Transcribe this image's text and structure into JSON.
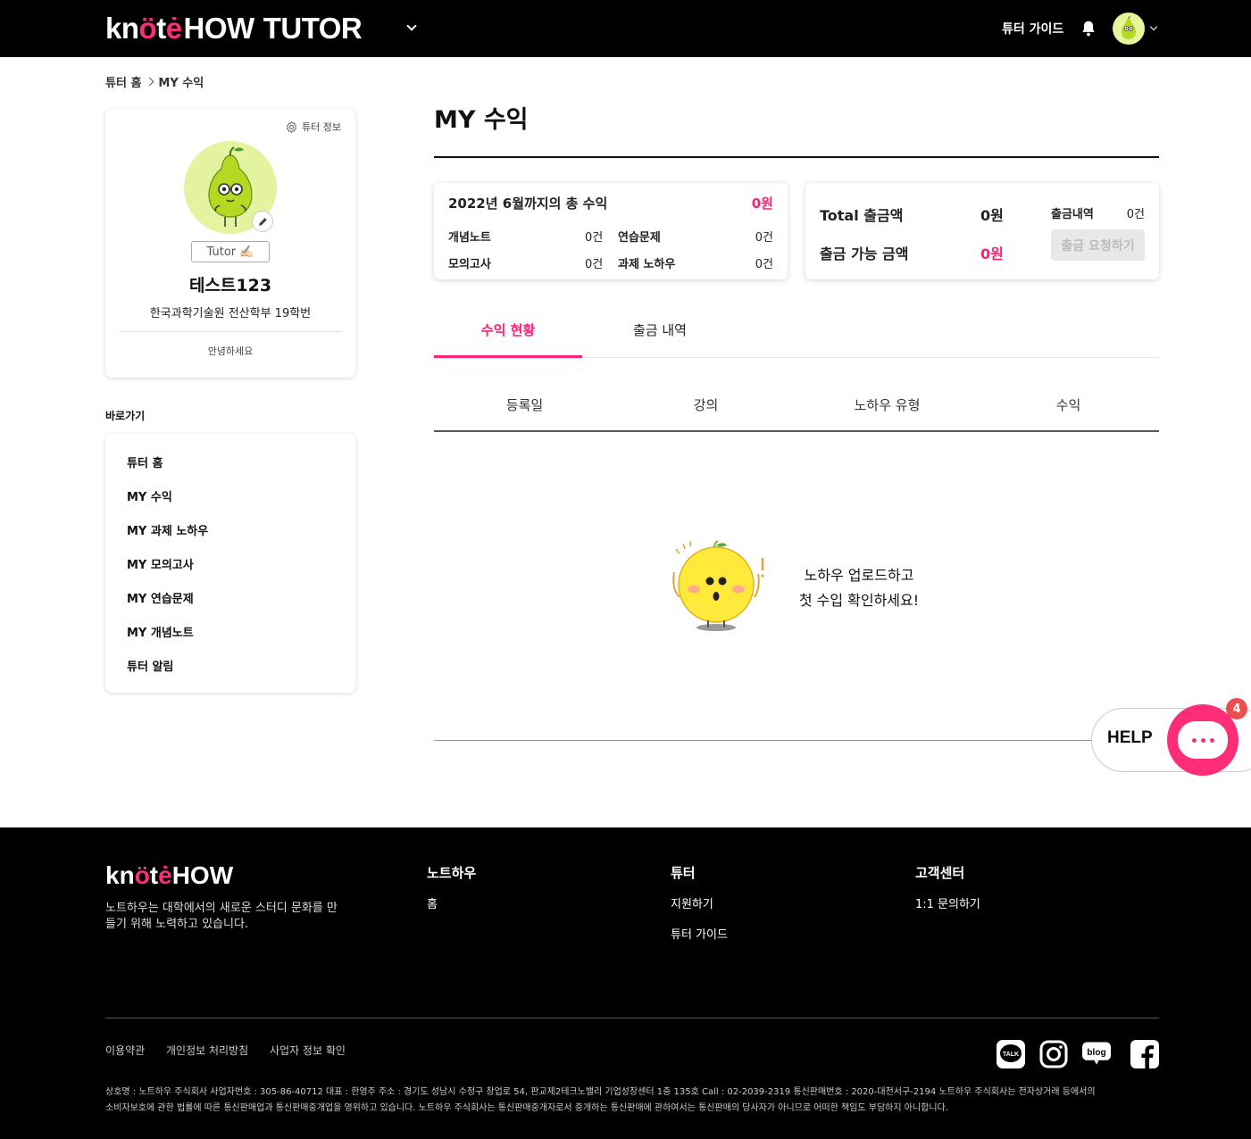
{
  "header": {
    "logo_k": "kn",
    "logo_o": "ö",
    "logo_t": "t",
    "logo_e": "ė",
    "logo_how": "HOW",
    "logo_tutor": "TUTOR",
    "guide_label": "튜터 가이드"
  },
  "breadcrumb": {
    "home": "튜터 홈",
    "current": "MY 수익"
  },
  "profile": {
    "settings_label": "튜터 정보",
    "badge": "Tutor ✍🏻",
    "name": "테스트123",
    "school": "한국과학기술원 전산학부 19학번",
    "greeting": "안녕하세요"
  },
  "shortcuts": {
    "title": "바로가기",
    "items": [
      "튜터 홈",
      "MY 수익",
      "MY 과제 노하우",
      "MY 모의고사",
      "MY 연습문제",
      "MY 개념노트",
      "튜터 알림"
    ]
  },
  "main": {
    "title": "MY 수익",
    "summary": {
      "total_label": "2022년 6월까지의 총 수익",
      "total_value": "0원",
      "rows": [
        {
          "label": "개념노트",
          "value": "0건"
        },
        {
          "label": "연습문제",
          "value": "0건"
        },
        {
          "label": "모의고사",
          "value": "0건"
        },
        {
          "label": "과제 노하우",
          "value": "0건"
        }
      ]
    },
    "withdraw": {
      "total_label": "Total 출금액",
      "total_value": "0원",
      "history_label": "출금내역",
      "history_value": "0건",
      "available_label": "출금 가능 금액",
      "available_value": "0원",
      "button": "출금 요청하기"
    },
    "tabs": [
      "수익 현황",
      "출금 내역"
    ],
    "columns": [
      "등록일",
      "강의",
      "노하우 유형",
      "수익"
    ],
    "empty_line1": "노하우 업로드하고",
    "empty_line2": "첫 수입 확인하세요!"
  },
  "help": {
    "label": "HELP",
    "count": "4"
  },
  "footer": {
    "logo_how": "HOW",
    "tagline": "노트하우는 대학에서의 새로운 스터디 문화를 만들기 위해 노력하고 있습니다.",
    "columns": [
      {
        "title": "노트하우",
        "links": [
          "홈"
        ]
      },
      {
        "title": "튜터",
        "links": [
          "지원하기",
          "튜터 가이드"
        ]
      },
      {
        "title": "고객센터",
        "links": [
          "1:1 문의하기"
        ]
      }
    ],
    "legal": [
      "이용약관",
      "개인정보 처리방침",
      "사업자 정보 확인"
    ],
    "company_line1": "상호명 : 노트하우 주식회사 사업자번호 : 305-86-40712 대표 : 한영주 주소 : 경기도 성남시 수정구 창업로 54, 판교제2테크노밸리 기업성장센터 1층 135호 Call : 02-2039-2319 통신판매번호 : 2020-대전서구-2194 노트하우 주식회사는 전자상거래 등에서의",
    "company_line2": "소비자보호에 관한 법률에 따른 통신판매업과 통신판매중개업을 영위하고 있습니다. 노트하우 주식회사는 통신판매중개자로서 중개하는 통신판매에 관하여서는 통신판매의 당사자가 아니므로 어떠한 책임도 부담하지 아니합니다.",
    "sns": [
      "talk",
      "instagram",
      "blog",
      "facebook"
    ],
    "sns_talk_label": "TALK",
    "sns_blog_label": "blog"
  },
  "colors": {
    "accent": "#ff1f76",
    "header_bg": "#000000",
    "help_bubble": "#ff2d78"
  }
}
